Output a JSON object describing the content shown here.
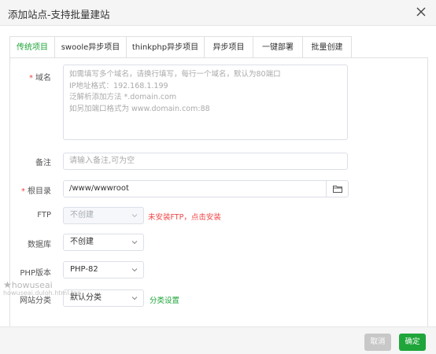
{
  "dialog": {
    "title": "添加站点-支持批量建站",
    "close_icon": "close-icon"
  },
  "tabs": [
    {
      "label": "传统项目",
      "active": true
    },
    {
      "label": "swoole异步项目"
    },
    {
      "label": "thinkphp异步项目"
    },
    {
      "label": "异步项目"
    },
    {
      "label": "一键部署"
    },
    {
      "label": "批量创建"
    }
  ],
  "form": {
    "domain": {
      "label": "域名",
      "placeholder_lines": [
        "如需填写多个域名，请换行填写，每行一个域名，默认为80端口",
        "IP地址格式：192.168.1.199",
        "泛解析添加方法 *.domain.com",
        "如另加端口格式为 www.domain.com:88"
      ]
    },
    "remark": {
      "label": "备注",
      "placeholder": "请输入备注,可为空"
    },
    "root": {
      "label": "根目录",
      "value": "/www/wwwroot",
      "icon": "folder-icon"
    },
    "ftp": {
      "label": "FTP",
      "value": "不创建",
      "hint": "未安装FTP，点击安装"
    },
    "database": {
      "label": "数据库",
      "value": "不创建"
    },
    "php": {
      "label": "PHP版本",
      "value": "PHP-82"
    },
    "category": {
      "label": "网站分类",
      "value": "默认分类",
      "link": "分类设置"
    }
  },
  "footer": {
    "cancel": "取消",
    "confirm": "确定"
  },
  "watermark": {
    "main": "howuseai",
    "sub": "howuseai.duloh.html.top"
  },
  "colors": {
    "accent": "#20a53a",
    "danger": "#f04646",
    "cancel": "#c8c8c8"
  }
}
